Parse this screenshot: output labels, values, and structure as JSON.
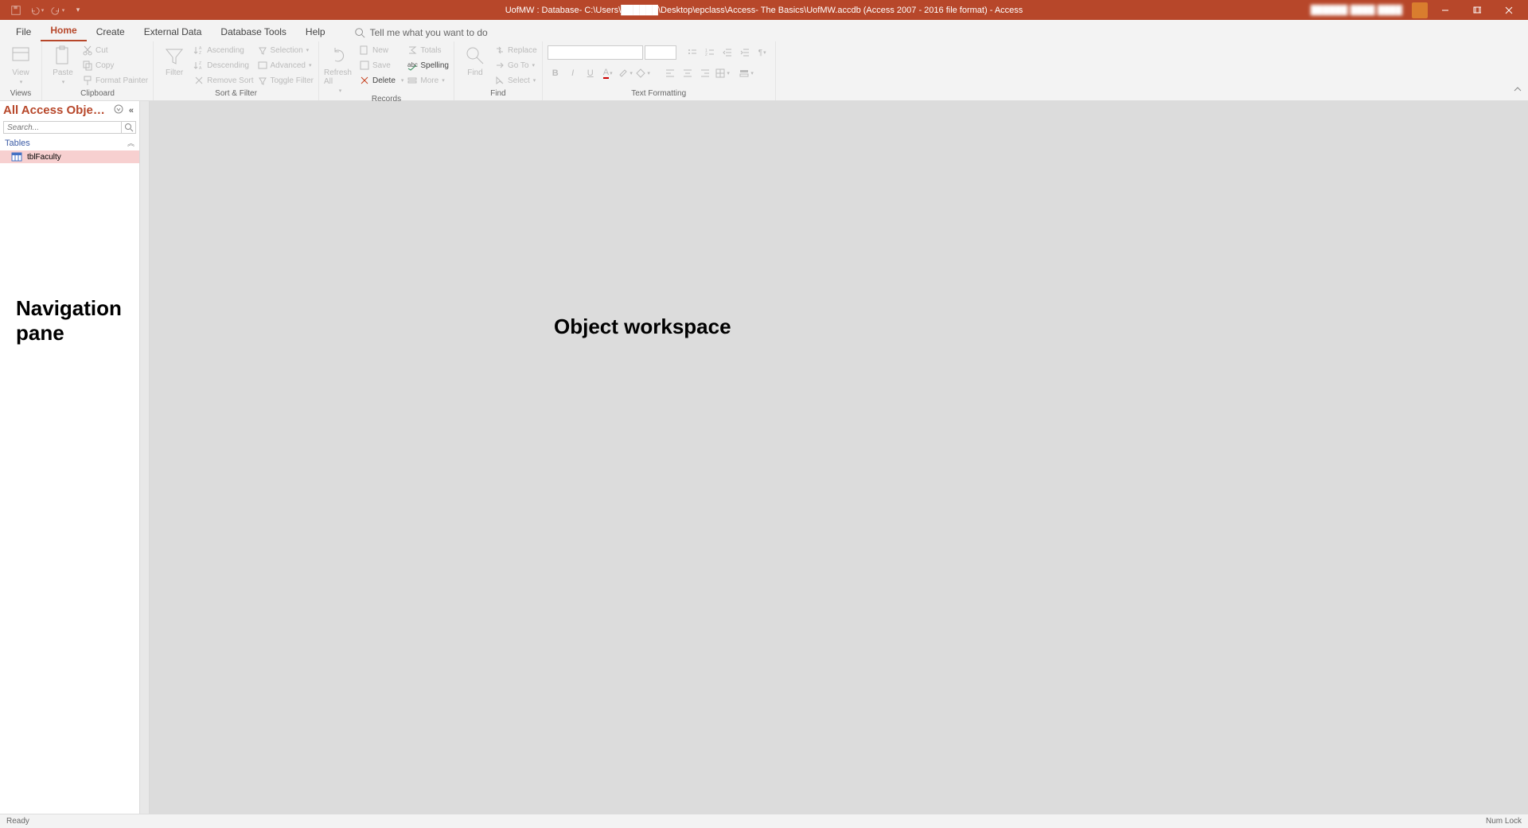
{
  "titlebar": {
    "title": "UofMW : Database- C:\\Users\\██████\\Desktop\\epclass\\Access- The Basics\\UofMW.accdb (Access 2007 - 2016 file format)  -  Access",
    "user": "██████ ████ ████"
  },
  "tabs": {
    "file": "File",
    "home": "Home",
    "create": "Create",
    "external": "External Data",
    "dbtools": "Database Tools",
    "help": "Help",
    "tellme": "Tell me what you want to do"
  },
  "ribbon": {
    "views": {
      "label": "Views",
      "view": "View"
    },
    "clipboard": {
      "label": "Clipboard",
      "paste": "Paste",
      "cut": "Cut",
      "copy": "Copy",
      "fmt": "Format Painter"
    },
    "sortfilter": {
      "label": "Sort & Filter",
      "filter": "Filter",
      "asc": "Ascending",
      "desc": "Descending",
      "remove": "Remove Sort",
      "selection": "Selection",
      "advanced": "Advanced",
      "toggle": "Toggle Filter"
    },
    "records": {
      "label": "Records",
      "refresh": "Refresh All",
      "new": "New",
      "save": "Save",
      "delete": "Delete",
      "totals": "Totals",
      "spelling": "Spelling",
      "more": "More"
    },
    "find": {
      "label": "Find",
      "find": "Find",
      "replace": "Replace",
      "goto": "Go To",
      "select": "Select"
    },
    "textfmt": {
      "label": "Text Formatting"
    }
  },
  "nav": {
    "title": "All Access Obje…",
    "search_ph": "Search...",
    "cat": "Tables",
    "items": [
      "tblFaculty"
    ]
  },
  "annot": {
    "navpane": "Navigation\npane",
    "workspace": "Object workspace"
  },
  "statusbar": {
    "ready": "Ready",
    "numlock": "Num Lock"
  }
}
